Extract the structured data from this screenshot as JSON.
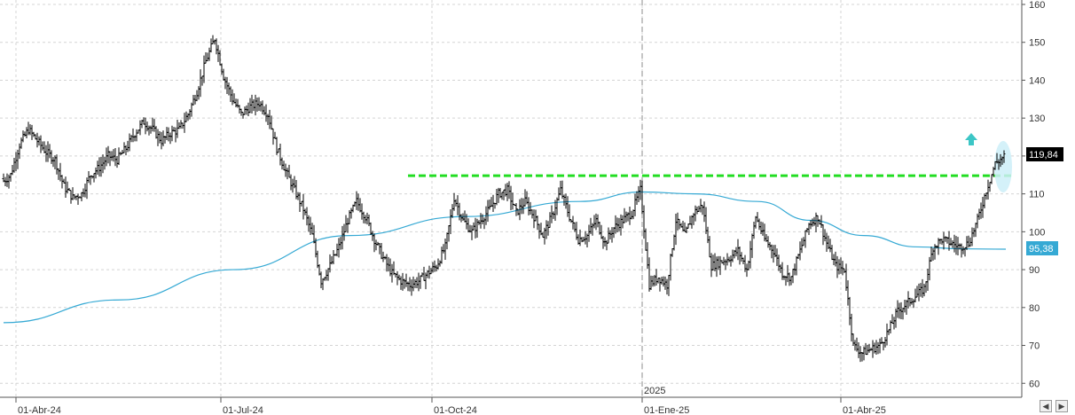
{
  "chart_data": {
    "type": "ohlc",
    "x_labels": [
      "01-Abr-24",
      "01-Jul-24",
      "01-Oct-24",
      "01-Ene-25",
      "01-Abr-25"
    ],
    "year_marker": "2025",
    "y_ticks": [
      60,
      70,
      80,
      90,
      100,
      110,
      120,
      130,
      140,
      150,
      160
    ],
    "ylim": [
      57,
      162
    ],
    "grid": true,
    "last_price": "119,84",
    "moving_average_last": "95,38",
    "resistance_level": 114.8,
    "colors": {
      "bars": "#000000",
      "moving_average": "#35a9d4",
      "resistance": "#22dd22",
      "signal_arrow": "#3cc6c6",
      "highlight": "#cdeef8",
      "grid": "#d4d4d4"
    },
    "series": [
      {
        "kind": "ohlc",
        "weekly_closes": [
          115,
          123,
          127,
          124,
          121,
          119,
          112,
          109,
          110,
          115,
          117,
          120,
          119,
          122,
          126,
          129,
          127,
          124,
          126,
          127,
          131,
          137,
          145,
          151,
          141,
          135,
          131,
          133,
          134,
          131,
          122,
          116,
          111,
          106,
          99,
          87,
          91,
          96,
          103,
          108,
          104,
          98,
          93,
          89,
          87,
          86,
          87,
          89,
          91,
          96,
          109,
          103,
          100,
          103,
          106,
          110,
          111,
          105,
          108,
          104,
          99,
          104,
          111,
          104,
          98,
          99,
          103,
          97,
          101,
          103,
          105,
          111,
          86,
          88,
          86,
          103,
          99,
          105,
          107,
          91,
          92,
          93,
          95,
          90,
          104,
          98,
          95,
          89,
          88,
          95,
          102,
          104,
          97,
          91,
          90,
          70,
          68,
          69,
          70,
          74,
          79,
          81,
          83,
          85,
          96,
          98,
          97,
          96,
          97,
          103,
          111,
          118,
          119.84
        ]
      },
      {
        "kind": "moving-average",
        "points": [
          [
            0,
            76
          ],
          [
            13,
            82
          ],
          [
            26,
            90
          ],
          [
            39,
            99
          ],
          [
            52,
            104
          ],
          [
            65,
            108
          ],
          [
            72,
            110.5
          ],
          [
            78,
            110
          ],
          [
            85,
            108
          ],
          [
            91,
            103
          ],
          [
            97,
            99
          ],
          [
            103,
            96
          ],
          [
            108,
            95.5
          ],
          [
            113,
            95.4
          ]
        ]
      }
    ]
  },
  "ui": {
    "scroll_left_icon": "chevron-left-icon",
    "scroll_right_icon": "chevron-right-icon",
    "signal_icon": "arrow-up-icon"
  }
}
